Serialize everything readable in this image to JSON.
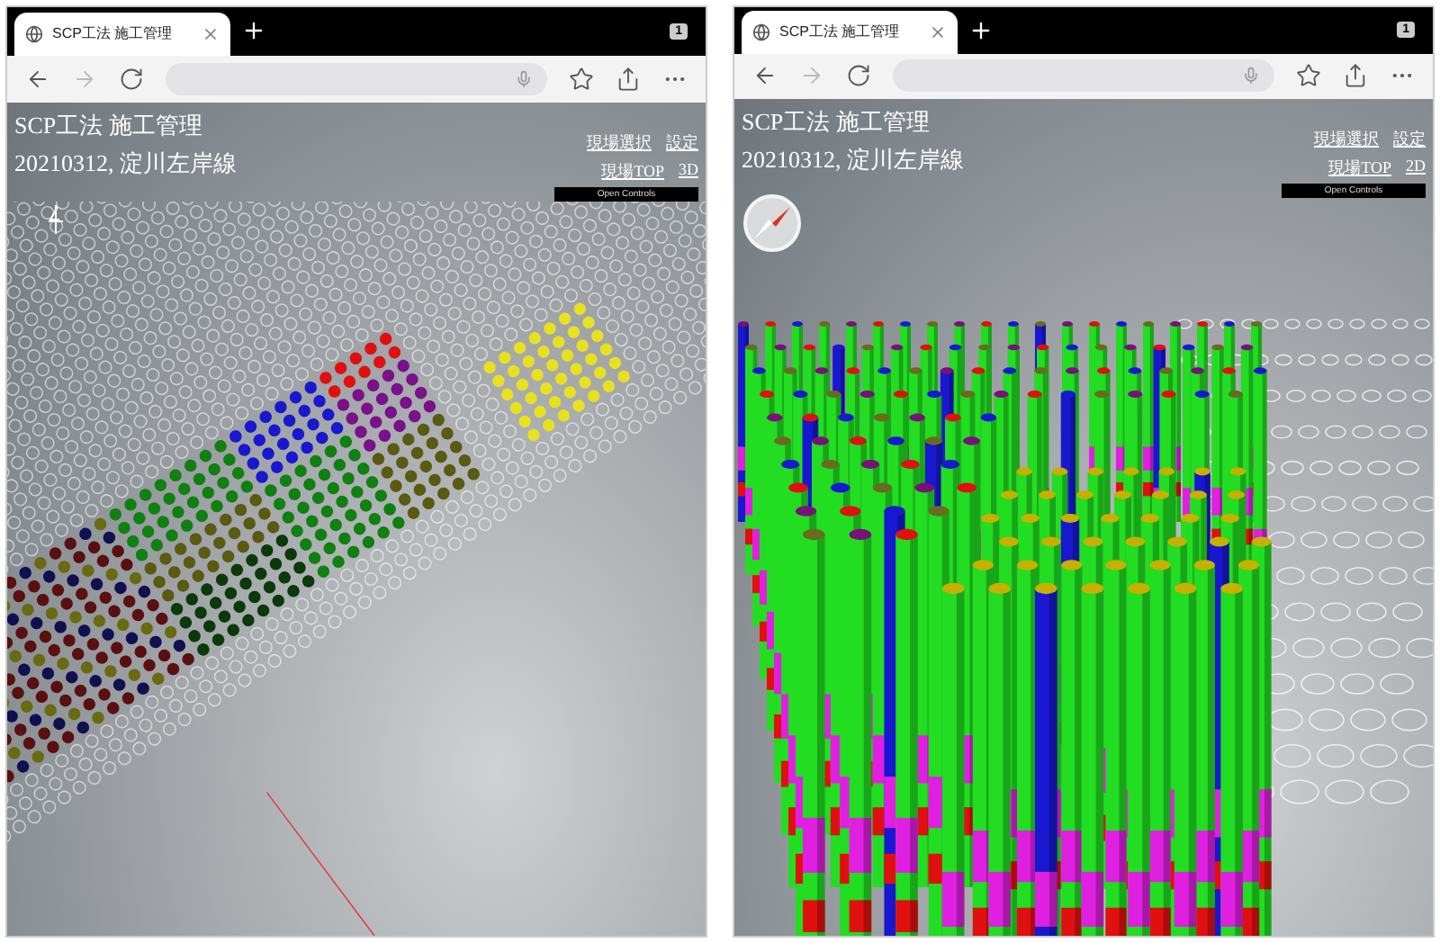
{
  "panels": [
    {
      "tab": {
        "title": "SCP工法 施工管理",
        "selected": true
      },
      "tab_count": "1",
      "header": {
        "title": "SCP工法 施工管理",
        "subtitle": "20210312, 淀川左岸線",
        "links": [
          [
            "現場選択",
            "設定"
          ],
          [
            "現場TOP",
            "3D"
          ]
        ]
      },
      "controls_button": "Open Controls",
      "view": {
        "kind": "plan"
      }
    },
    {
      "tab": {
        "title": "SCP工法 施工管理",
        "selected": true
      },
      "tab_count": "1",
      "header": {
        "title": "SCP工法 施工管理",
        "subtitle": "20210312, 淀川左岸線",
        "links": [
          [
            "現場選択",
            "設定"
          ],
          [
            "現場TOP",
            "2D"
          ]
        ]
      },
      "controls_button": "Open Controls",
      "view": {
        "kind": "perspective"
      }
    }
  ]
}
